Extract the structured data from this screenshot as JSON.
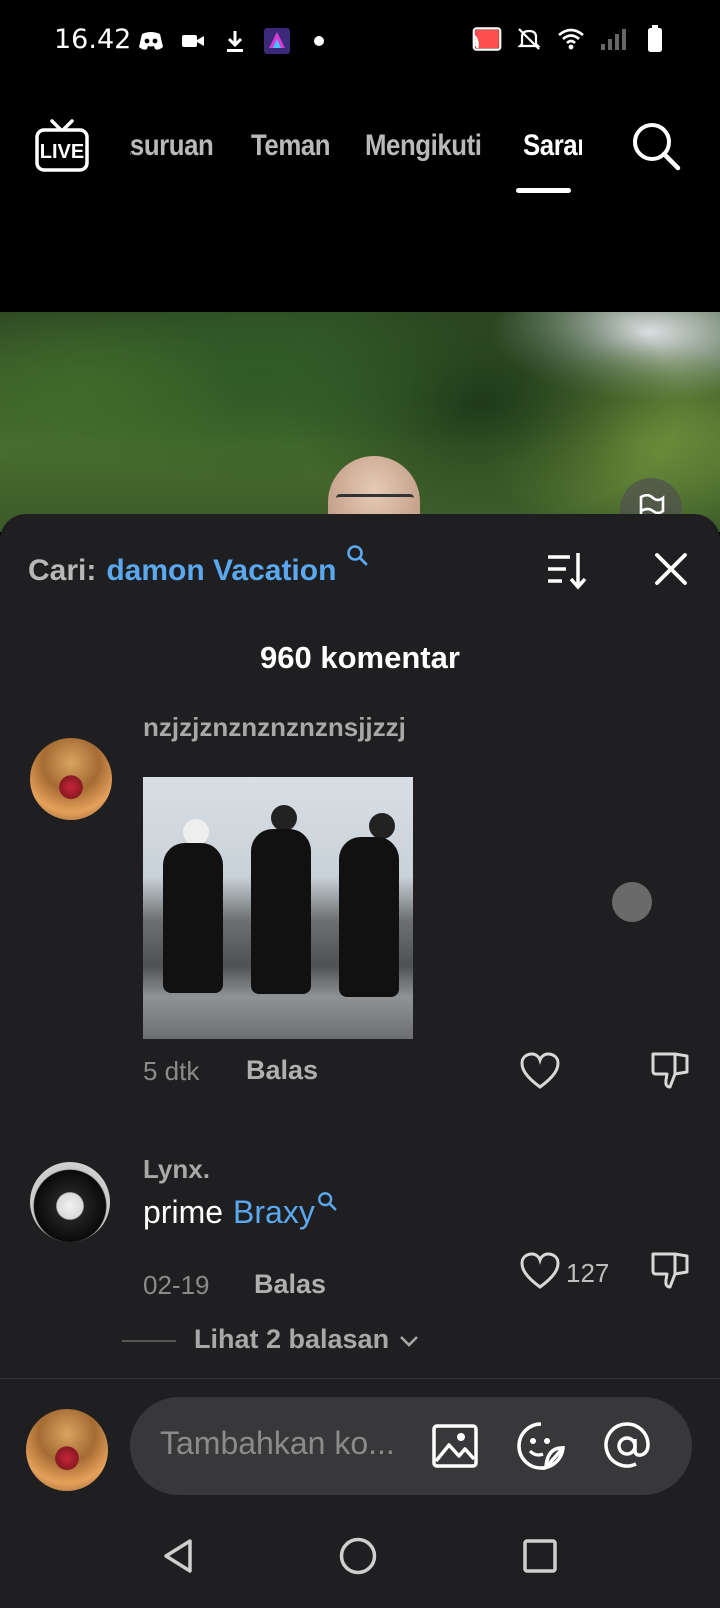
{
  "status_bar": {
    "time": "16.42",
    "left_icons": [
      "discord-icon",
      "video-camera-icon",
      "download-icon",
      "game-app-icon",
      "dot-icon"
    ],
    "right_icons": [
      "cast-icon",
      "mute-icon",
      "wifi-icon",
      "signal-icon",
      "battery-icon"
    ]
  },
  "top_nav": {
    "live_label": "LIVE",
    "tabs": [
      {
        "label": "Jelajah Asuruan",
        "visible_label": "asuruan"
      },
      {
        "label": "Teman"
      },
      {
        "label": "Mengikuti"
      },
      {
        "label": "Saran",
        "active": true
      }
    ]
  },
  "comments_sheet": {
    "search_prefix": "Cari:",
    "search_term": "damon Vacation",
    "count_label": "960 komentar",
    "comments": [
      {
        "username": "nzjzjznznznznznsjjzzj",
        "has_image": true,
        "time": "5 dtk",
        "reply_label": "Balas",
        "likes": ""
      },
      {
        "username": "Lynx.",
        "text": "prime",
        "mention": "Braxy",
        "time": "02-19",
        "reply_label": "Balas",
        "likes": "127",
        "view_replies": "Lihat 2 balasan"
      }
    ]
  },
  "composer": {
    "placeholder": "Tambahkan ko..."
  },
  "colors": {
    "accent_blue": "#5aa9f0",
    "sheet_bg": "#1f1f21",
    "pill_bg": "#38383a"
  }
}
